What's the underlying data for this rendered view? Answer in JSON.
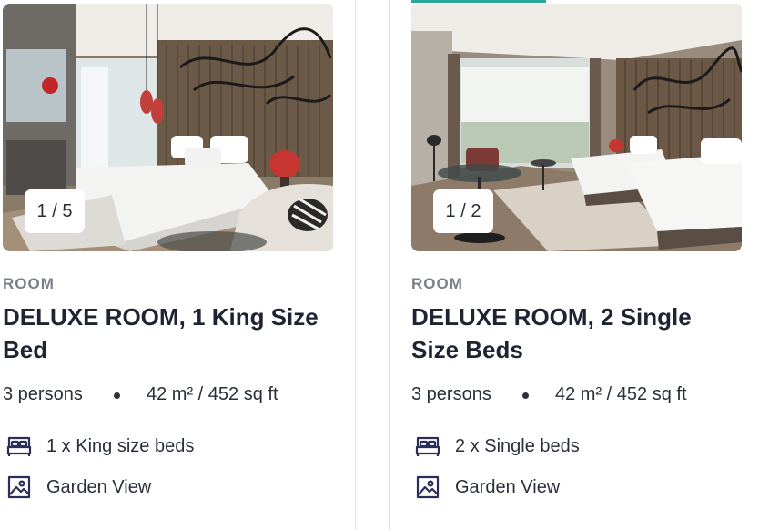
{
  "cards": [
    {
      "image_counter": "1 / 5",
      "category": "ROOM",
      "title": "DELUXE ROOM, 1 King Size Bed",
      "persons": "3 persons",
      "area": "42 m² / 452 sq ft",
      "bed": {
        "icon": "bed-icon",
        "label": "1 x King size beds"
      },
      "view": {
        "icon": "landscape-image-icon",
        "label": "Garden View"
      }
    },
    {
      "image_counter": "1 / 2",
      "category": "ROOM",
      "title": "DELUXE ROOM, 2 Single Size Beds",
      "persons": "3 persons",
      "area": "42 m² / 452 sq ft",
      "bed": {
        "icon": "bed-icon",
        "label": "2 x Single beds"
      },
      "view": {
        "icon": "landscape-image-icon",
        "label": "Garden View"
      }
    }
  ],
  "colors": {
    "accent": "#2aa89a",
    "text": "#1f2433",
    "muted": "#7b7f86",
    "icon": "#2c2e5a"
  }
}
